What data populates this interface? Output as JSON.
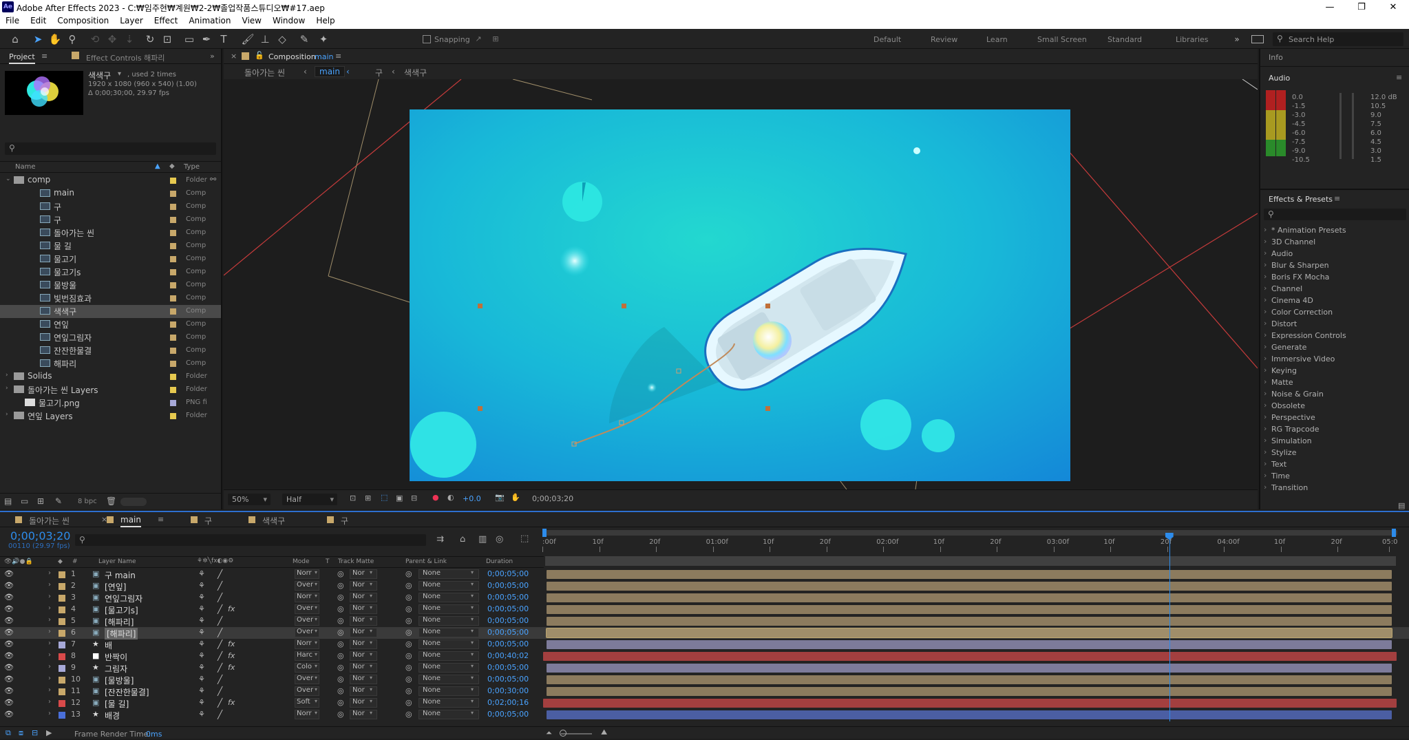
{
  "window": {
    "title": "Adobe After Effects 2023 - C:₩임주현₩계원₩2-2₩졸업작품스튜디오₩#17.aep",
    "app_icon": "Ae"
  },
  "menu": [
    "File",
    "Edit",
    "Composition",
    "Layer",
    "Effect",
    "Animation",
    "View",
    "Window",
    "Help"
  ],
  "toolbar": {
    "snapping": "Snapping",
    "workspaces": [
      "Default",
      "Review",
      "Learn",
      "Small Screen",
      "Standard",
      "Libraries"
    ],
    "search_placeholder": "Search Help"
  },
  "project": {
    "tab": "Project",
    "tab2": "Effect Controls 해파리",
    "selected_name": "색색구",
    "used": ", used 2 times",
    "info1": "1920 x 1080  (960 x 540) (1.00)",
    "info2": "Δ 0;00;30;00, 29.97 fps",
    "col_name": "Name",
    "col_type": "Type",
    "bpc": "8 bpc",
    "items": [
      {
        "name": "comp",
        "type": "Folder",
        "kind": "folder",
        "indent": 0,
        "color": "#e6c94f"
      },
      {
        "name": "main",
        "type": "Comp",
        "kind": "comp",
        "indent": 1,
        "color": "#c8a86a"
      },
      {
        "name": "구",
        "type": "Comp",
        "kind": "comp",
        "indent": 1,
        "color": "#c8a86a"
      },
      {
        "name": "구",
        "type": "Comp",
        "kind": "comp",
        "indent": 1,
        "color": "#c8a86a"
      },
      {
        "name": "돌아가는 씬",
        "type": "Comp",
        "kind": "comp",
        "indent": 1,
        "color": "#c8a86a"
      },
      {
        "name": "물 길",
        "type": "Comp",
        "kind": "comp",
        "indent": 1,
        "color": "#c8a86a"
      },
      {
        "name": "물고기",
        "type": "Comp",
        "kind": "comp",
        "indent": 1,
        "color": "#c8a86a"
      },
      {
        "name": "물고기s",
        "type": "Comp",
        "kind": "comp",
        "indent": 1,
        "color": "#c8a86a"
      },
      {
        "name": "물방울",
        "type": "Comp",
        "kind": "comp",
        "indent": 1,
        "color": "#c8a86a"
      },
      {
        "name": "빛번짐효과",
        "type": "Comp",
        "kind": "comp",
        "indent": 1,
        "color": "#c8a86a"
      },
      {
        "name": "색색구",
        "type": "Comp",
        "kind": "comp",
        "indent": 1,
        "color": "#c8a86a",
        "selected": true
      },
      {
        "name": "연잎",
        "type": "Comp",
        "kind": "comp",
        "indent": 1,
        "color": "#c8a86a"
      },
      {
        "name": "연잎그림자",
        "type": "Comp",
        "kind": "comp",
        "indent": 1,
        "color": "#c8a86a"
      },
      {
        "name": "잔잔한물결",
        "type": "Comp",
        "kind": "comp",
        "indent": 1,
        "color": "#c8a86a"
      },
      {
        "name": "해파리",
        "type": "Comp",
        "kind": "comp",
        "indent": 1,
        "color": "#c8a86a"
      },
      {
        "name": "Solids",
        "type": "Folder",
        "kind": "folder",
        "indent": 0,
        "color": "#e6c94f"
      },
      {
        "name": "돌아가는 씬 Layers",
        "type": "Folder",
        "kind": "folder",
        "indent": 0,
        "color": "#e6c94f"
      },
      {
        "name": "물고기.png",
        "type": "PNG fi",
        "kind": "file",
        "indent": 0,
        "color": "#a7a9d8"
      },
      {
        "name": "연잎 Layers",
        "type": "Folder",
        "kind": "folder",
        "indent": 0,
        "color": "#e6c94f"
      }
    ]
  },
  "composition": {
    "tab": "Composition",
    "tab_name": "main",
    "breadcrumb": [
      "돌아가는 씬",
      "main",
      "구",
      "색색구"
    ],
    "zoom": "50%",
    "resolution": "Half",
    "exposure": "+0.0",
    "timecode": "0;00;03;20"
  },
  "right": {
    "info": "Info",
    "audio": "Audio",
    "audio_left": [
      "0.0",
      "-1.5",
      "-3.0",
      "-4.5",
      "-6.0",
      "-7.5",
      "-9.0",
      "-10.5"
    ],
    "audio_right": [
      "12.0 dB",
      "10.5",
      "9.0",
      "7.5",
      "6.0",
      "4.5",
      "3.0",
      "1.5"
    ],
    "effects_title": "Effects & Presets",
    "effects": [
      "* Animation Presets",
      "3D Channel",
      "Audio",
      "Blur & Sharpen",
      "Boris FX Mocha",
      "Channel",
      "Cinema 4D",
      "Color Correction",
      "Distort",
      "Expression Controls",
      "Generate",
      "Immersive Video",
      "Keying",
      "Matte",
      "Noise & Grain",
      "Obsolete",
      "Perspective",
      "RG Trapcode",
      "Simulation",
      "Stylize",
      "Text",
      "Time",
      "Transition"
    ]
  },
  "timeline": {
    "tabs": [
      {
        "label": "돌아가는 씬",
        "color": "#c8a86a"
      },
      {
        "label": "main",
        "color": "#c8a86a",
        "active": true
      },
      {
        "label": "구",
        "color": "#c8a86a"
      },
      {
        "label": "색색구",
        "color": "#c8a86a"
      },
      {
        "label": "구",
        "color": "#c8a86a"
      }
    ],
    "timecode": "0;00;03;20",
    "frame_info": "00110 (29.97 fps)",
    "headers": {
      "layer_name": "Layer Name",
      "mode": "Mode",
      "t": "T",
      "track_matte": "Track Matte",
      "parent": "Parent & Link",
      "duration": "Duration"
    },
    "ruler": [
      ":00f",
      "10f",
      "20f",
      "01:00f",
      "10f",
      "20f",
      "02:00f",
      "10f",
      "20f",
      "03:00f",
      "10f",
      "20f",
      "04:00f",
      "10f",
      "20f",
      "05:0"
    ],
    "playhead_seconds": 3.67,
    "layers": [
      {
        "n": "1",
        "name": "구 main",
        "kind": "comp",
        "color": "#c8a86a",
        "mode": "Norr",
        "matte": "Nor",
        "parent": "None",
        "dur": "0;00;05;00",
        "fx": false,
        "bar": "#8c7b5e",
        "bar_start": 0.0,
        "bar_end": 1.0
      },
      {
        "n": "2",
        "name": "[연잎]",
        "kind": "comp",
        "color": "#c8a86a",
        "mode": "Over",
        "matte": "Nor",
        "parent": "None",
        "dur": "0;00;05;00",
        "fx": false,
        "bar": "#8c7b5e",
        "bar_start": 0.0,
        "bar_end": 1.0
      },
      {
        "n": "3",
        "name": "연잎그림자",
        "kind": "comp",
        "color": "#c8a86a",
        "mode": "Norr",
        "matte": "Nor",
        "parent": "None",
        "dur": "0;00;05;00",
        "fx": false,
        "bar": "#8c7b5e",
        "bar_start": 0.0,
        "bar_end": 1.0
      },
      {
        "n": "4",
        "name": "[물고기s]",
        "kind": "comp",
        "color": "#c8a86a",
        "mode": "Over",
        "matte": "Nor",
        "parent": "None",
        "dur": "0;00;05;00",
        "fx": true,
        "bar": "#8c7b5e",
        "bar_start": 0.0,
        "bar_end": 1.0
      },
      {
        "n": "5",
        "name": "[해파리]",
        "kind": "comp",
        "color": "#c8a86a",
        "mode": "Over",
        "matte": "Nor",
        "parent": "None",
        "dur": "0;00;05;00",
        "fx": false,
        "bar": "#8c7b5e",
        "bar_start": 0.0,
        "bar_end": 1.0
      },
      {
        "n": "6",
        "name": "[해파리]",
        "kind": "comp",
        "color": "#c8a86a",
        "mode": "Over",
        "matte": "Nor",
        "parent": "None",
        "dur": "0;00;05;00",
        "fx": false,
        "bar": "#a08e6a",
        "bar_start": 0.0,
        "bar_end": 1.0,
        "selected": true
      },
      {
        "n": "7",
        "name": "배",
        "kind": "shape",
        "color": "#a7a9d8",
        "mode": "Norr",
        "matte": "Nor",
        "parent": "None",
        "dur": "0;00;05;00",
        "fx": true,
        "bar": "#7d7b9a",
        "bar_start": 0.0,
        "bar_end": 1.0
      },
      {
        "n": "8",
        "name": "반짝이",
        "kind": "solid",
        "color": "#d94a4a",
        "mode": "Harc",
        "matte": "Nor",
        "parent": "None",
        "dur": "0;00;40;02",
        "fx": true,
        "bar": "#a33f3f",
        "bar_start": 0.0,
        "bar_end": 1.0
      },
      {
        "n": "9",
        "name": "그림자",
        "kind": "shape",
        "color": "#a7a9d8",
        "mode": "Colo",
        "matte": "Nor",
        "parent": "None",
        "dur": "0;00;05;00",
        "fx": true,
        "bar": "#7d7b9a",
        "bar_start": 0.0,
        "bar_end": 1.0
      },
      {
        "n": "10",
        "name": "[물방울]",
        "kind": "comp",
        "color": "#c8a86a",
        "mode": "Over",
        "matte": "Nor",
        "parent": "None",
        "dur": "0;00;05;00",
        "fx": false,
        "bar": "#8c7b5e",
        "bar_start": 0.0,
        "bar_end": 1.0
      },
      {
        "n": "11",
        "name": "[잔잔한물결]",
        "kind": "comp",
        "color": "#c8a86a",
        "mode": "Over",
        "matte": "Nor",
        "parent": "None",
        "dur": "0;00;30;00",
        "fx": false,
        "bar": "#8c7b5e",
        "bar_start": 0.0,
        "bar_end": 1.0
      },
      {
        "n": "12",
        "name": "[물 길]",
        "kind": "comp",
        "color": "#d94a4a",
        "mode": "Soft",
        "matte": "Nor",
        "parent": "None",
        "dur": "0;02;00;16",
        "fx": true,
        "bar": "#a33f3f",
        "bar_start": 0.0,
        "bar_end": 1.0
      },
      {
        "n": "13",
        "name": "배경",
        "kind": "star",
        "color": "#4a6fd9",
        "mode": "Norr",
        "matte": "Nor",
        "parent": "None",
        "dur": "0;00;05;00",
        "fx": false,
        "bar": "#4b5ea3",
        "bar_start": 0.0,
        "bar_end": 1.0
      }
    ],
    "render_label": "Frame Render Time:",
    "render_value": "0ms"
  }
}
